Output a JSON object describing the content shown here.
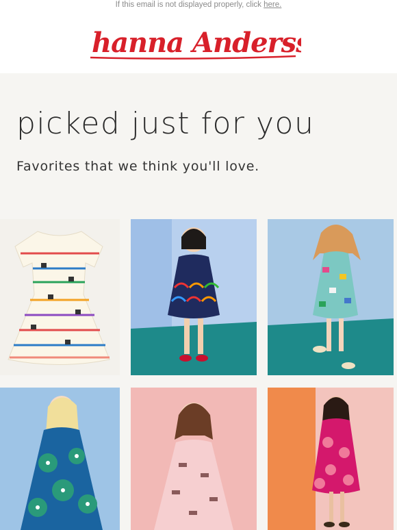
{
  "preheader": {
    "text": "If this email is not displayed properly, click ",
    "link": "here."
  },
  "brand": {
    "logo_text": "hanna Andersson",
    "color": "#d8202a"
  },
  "hero": {
    "title": "picked just for you",
    "subtitle": "Favorites that we think you'll love."
  },
  "products": [
    {
      "name": "striped-cat-dress-flatlay",
      "bg": "#f3f1ec"
    },
    {
      "name": "rainbow-dress-model",
      "bg": "#9fbfe7"
    },
    {
      "name": "teal-cat-dress-model",
      "bg": "#a9c9e5"
    },
    {
      "name": "blue-floral-dress-model",
      "bg": "#9ec4e6"
    },
    {
      "name": "pink-unicorn-dress-model",
      "bg": "#f2b9b6"
    },
    {
      "name": "magenta-tulip-dress-model",
      "bg": "#f3c4bd"
    }
  ]
}
